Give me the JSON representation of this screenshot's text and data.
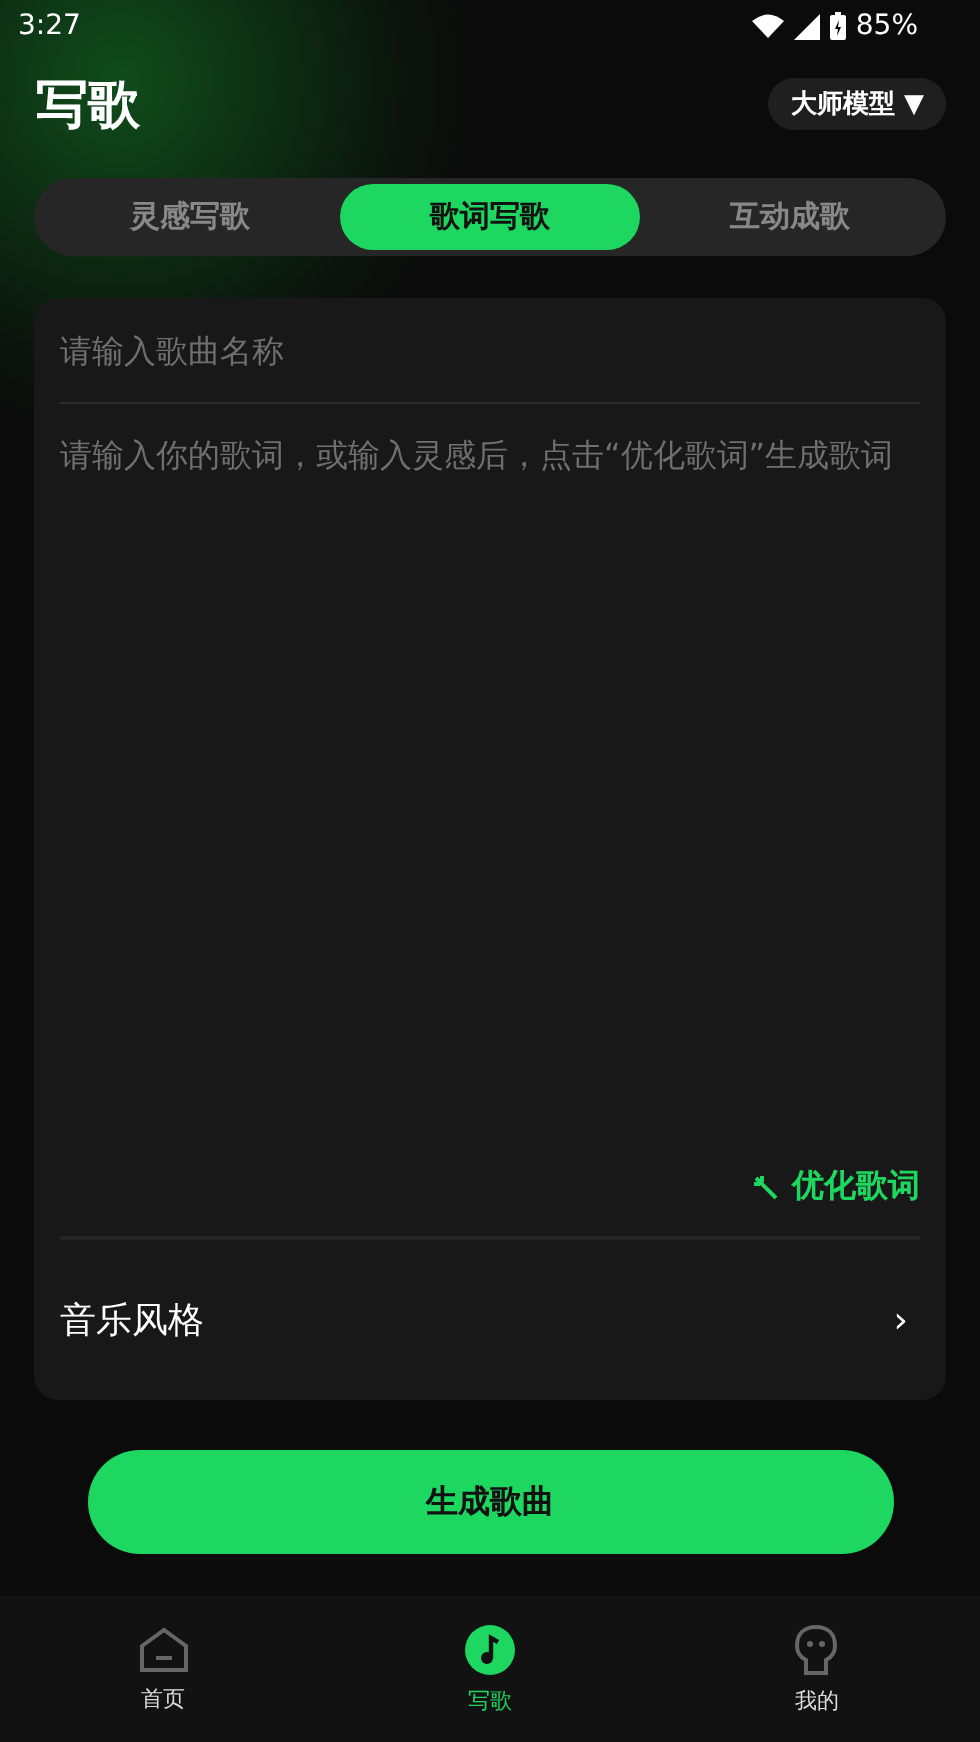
{
  "status_bar": {
    "time": "3:27",
    "battery": "85%"
  },
  "header": {
    "title": "写歌",
    "model_button": "大师模型 ▼"
  },
  "tabs": [
    {
      "label": "灵感写歌",
      "selected": false
    },
    {
      "label": "歌词写歌",
      "selected": true
    },
    {
      "label": "互动成歌",
      "selected": false
    }
  ],
  "form": {
    "title_field": {
      "placeholder": "请输入歌曲名称"
    },
    "lyrics_field": {
      "placeholder": "请输入你的歌词，或输入灵感后，点击“优化歌词”生成歌词"
    },
    "optimize_button": "优化歌词",
    "style_row": {
      "label": "音乐风格",
      "chevron": "›"
    }
  },
  "generate_button": "生成歌曲",
  "bottom_nav": [
    {
      "label": "首页",
      "kind": "home",
      "selected": false
    },
    {
      "label": "写歌",
      "kind": "music",
      "selected": true
    },
    {
      "label": "我的",
      "kind": "face",
      "selected": false
    }
  ]
}
